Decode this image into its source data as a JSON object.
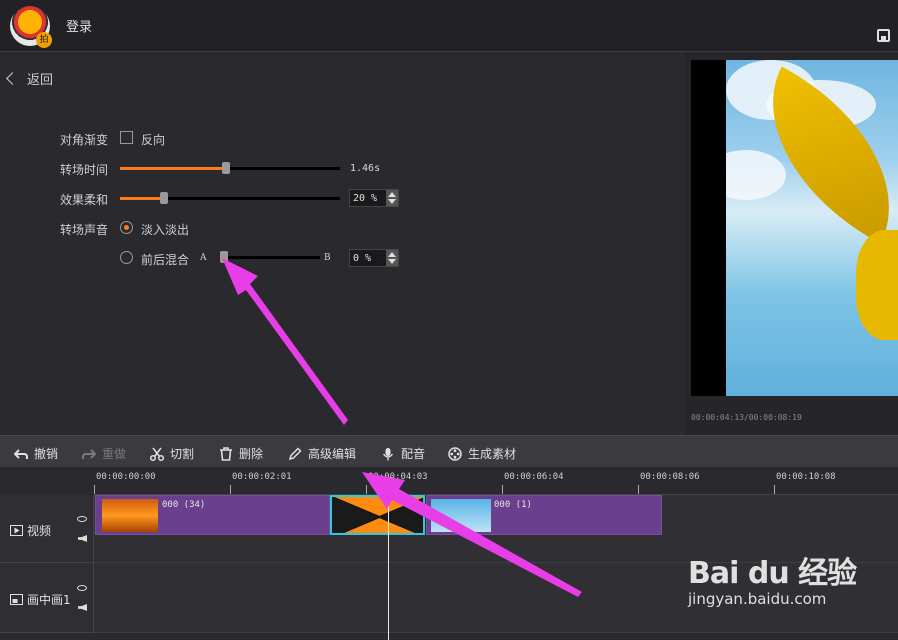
{
  "header": {
    "login_label": "登录"
  },
  "panel": {
    "back_label": "返回",
    "diagonal_label": "对角渐变",
    "reverse_label": "反向",
    "duration_label": "转场时间",
    "duration_value": "1.46s",
    "duration_fraction": 0.48,
    "softness_label": "效果柔和",
    "softness_value": "20 %",
    "softness_fraction": 0.2,
    "sound_label": "转场声音",
    "fade_label": "淡入淡出",
    "mix_label": "前后混合",
    "mix_a": "A",
    "mix_b": "B",
    "mix_value": "0 %",
    "mix_fraction": 0.0
  },
  "preview": {
    "timecode": "00:00:04:13/00:00:08:19"
  },
  "toolbar": {
    "undo": "撤销",
    "redo": "重做",
    "cut": "切割",
    "delete": "删除",
    "advanced_edit": "高级编辑",
    "dub": "配音",
    "generate": "生成素材"
  },
  "ruler": {
    "ticks": [
      "00:00:00:00",
      "00:00:02:01",
      "00:00:04:03",
      "00:00:06:04",
      "00:00:08:06",
      "00:00:10:08"
    ]
  },
  "tracks": {
    "video_label": "视频",
    "pip_label": "画中画1",
    "clip1_label": "000 (34)",
    "clip2_label": "000 (1)"
  },
  "watermark": {
    "brand": "Bai du 经验",
    "url": "jingyan.baidu.com"
  },
  "colors": {
    "accent": "#ff7a1a",
    "clip": "#6a3f8e",
    "transition_border": "#2bc8e0",
    "annotation_arrow": "#e83ee8"
  }
}
